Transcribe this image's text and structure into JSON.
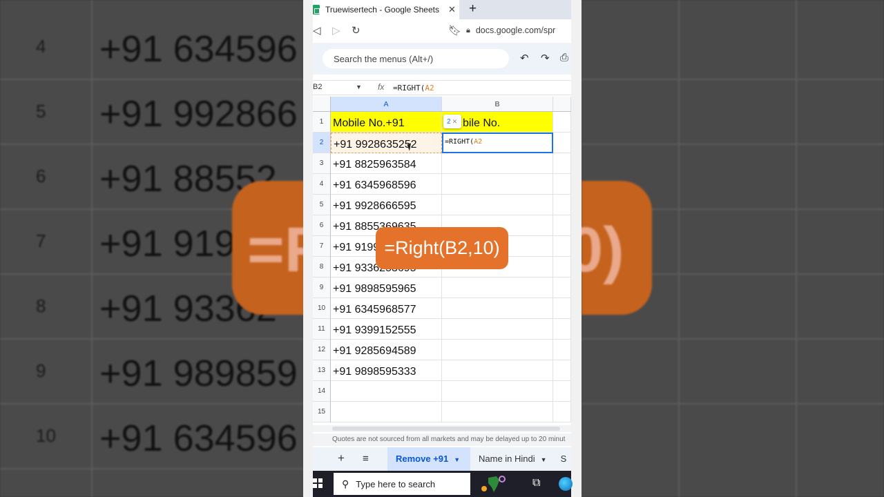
{
  "background": {
    "rows": [
      {
        "num": "4",
        "value": "+91 634596"
      },
      {
        "num": "5",
        "value": "+91 992866"
      },
      {
        "num": "6",
        "value": "+91 88552"
      },
      {
        "num": "7",
        "value": "+91 919"
      },
      {
        "num": "8",
        "value": "+91 93362"
      },
      {
        "num": "9",
        "value": "+91 989859"
      },
      {
        "num": "10",
        "value": "+91 634596"
      }
    ],
    "overlay_left": "=R",
    "overlay_right": "0)"
  },
  "browser": {
    "tab_title": "Truewisertech - Google Sheets",
    "url": "docs.google.com/spr"
  },
  "sheets": {
    "search_placeholder": "Search the menus (Alt+/)",
    "name_box": "B2",
    "formula_prefix": "=RIGHT(",
    "formula_ref": "A2",
    "col_a": "A",
    "col_b": "B",
    "row1_a": "Mobile No.+91",
    "row1_b": "bile No.",
    "chip_num": "2",
    "rows": [
      {
        "num": "2",
        "value": "+91 9928635252"
      },
      {
        "num": "3",
        "value": "+91 8825963584"
      },
      {
        "num": "4",
        "value": "+91 6345968596"
      },
      {
        "num": "5",
        "value": "+91 9928666595"
      },
      {
        "num": "6",
        "value": "+91 8855369635"
      },
      {
        "num": "7",
        "value": "+91 9199"
      },
      {
        "num": "8",
        "value": "+91 9336253695"
      },
      {
        "num": "9",
        "value": "+91 9898595965"
      },
      {
        "num": "10",
        "value": "+91 6345968577"
      },
      {
        "num": "11",
        "value": "+91 9399152555"
      },
      {
        "num": "12",
        "value": "+91 9285694589"
      },
      {
        "num": "13",
        "value": "+91 9898595333"
      },
      {
        "num": "14",
        "value": ""
      },
      {
        "num": "15",
        "value": ""
      }
    ],
    "row1_num": "1",
    "quote_text": "Quotes are not sourced from all markets and may be delayed up to 20 minut",
    "sheet_tabs": [
      "Remove +91",
      "Name in Hindi",
      "S"
    ]
  },
  "taskbar": {
    "search_text": "Type here to search"
  },
  "overlay_text": "=Right(B2,10)"
}
